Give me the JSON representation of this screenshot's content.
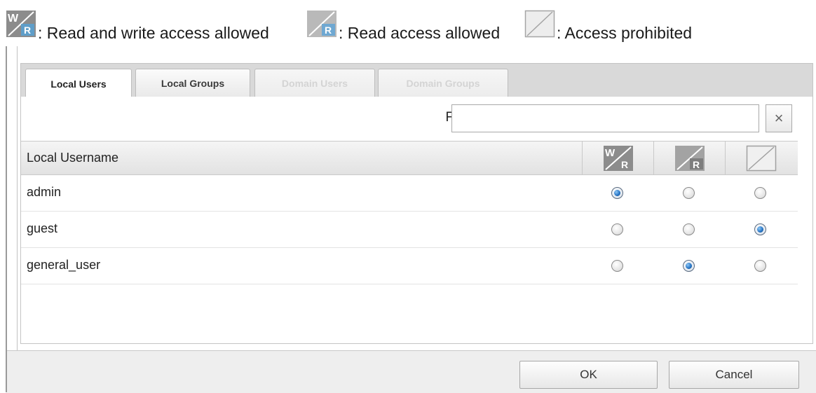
{
  "legend": {
    "read_write": ": Read and write access allowed",
    "read": ": Read access allowed",
    "prohibited": ": Access prohibited"
  },
  "tabs": [
    {
      "label": "Local Users",
      "state": "active"
    },
    {
      "label": "Local Groups",
      "state": "normal"
    },
    {
      "label": "Domain Users",
      "state": "disabled"
    },
    {
      "label": "Domain Groups",
      "state": "disabled"
    }
  ],
  "filter": {
    "label": "Filter:",
    "value": "",
    "clear_label": "×"
  },
  "table": {
    "column_header": "Local Username",
    "permission_columns": [
      "read-write-icon",
      "read-icon",
      "prohibited-icon"
    ],
    "rows": [
      {
        "name": "admin",
        "permission": "read-write"
      },
      {
        "name": "guest",
        "permission": "prohibited"
      },
      {
        "name": "general_user",
        "permission": "read"
      }
    ]
  },
  "buttons": {
    "ok": "OK",
    "cancel": "Cancel"
  },
  "colors": {
    "radio_selected": "#2a78c8",
    "header_bg": "#e2e2e2",
    "footer_bg": "#eeeeee"
  }
}
